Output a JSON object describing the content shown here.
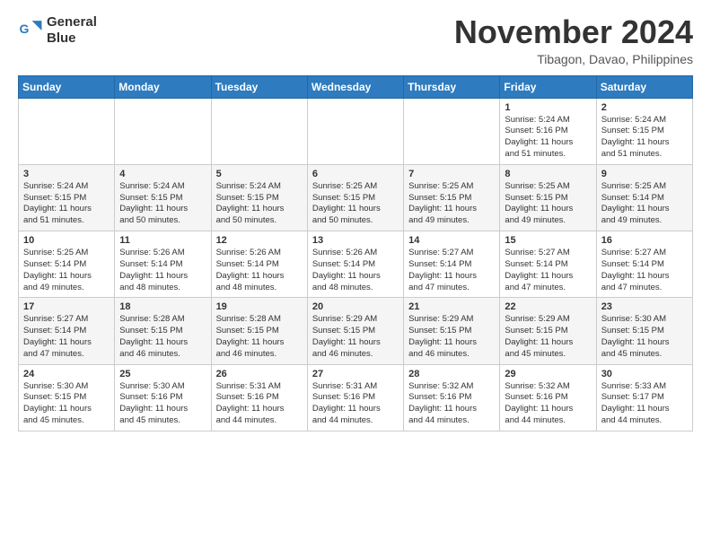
{
  "header": {
    "logo_line1": "General",
    "logo_line2": "Blue",
    "month_title": "November 2024",
    "location": "Tibagon, Davao, Philippines"
  },
  "days_of_week": [
    "Sunday",
    "Monday",
    "Tuesday",
    "Wednesday",
    "Thursday",
    "Friday",
    "Saturday"
  ],
  "weeks": [
    {
      "row_class": "row-1",
      "days": [
        {
          "num": "",
          "info": ""
        },
        {
          "num": "",
          "info": ""
        },
        {
          "num": "",
          "info": ""
        },
        {
          "num": "",
          "info": ""
        },
        {
          "num": "",
          "info": ""
        },
        {
          "num": "1",
          "info": "Sunrise: 5:24 AM\nSunset: 5:16 PM\nDaylight: 11 hours\nand 51 minutes."
        },
        {
          "num": "2",
          "info": "Sunrise: 5:24 AM\nSunset: 5:15 PM\nDaylight: 11 hours\nand 51 minutes."
        }
      ]
    },
    {
      "row_class": "row-2",
      "days": [
        {
          "num": "3",
          "info": "Sunrise: 5:24 AM\nSunset: 5:15 PM\nDaylight: 11 hours\nand 51 minutes."
        },
        {
          "num": "4",
          "info": "Sunrise: 5:24 AM\nSunset: 5:15 PM\nDaylight: 11 hours\nand 50 minutes."
        },
        {
          "num": "5",
          "info": "Sunrise: 5:24 AM\nSunset: 5:15 PM\nDaylight: 11 hours\nand 50 minutes."
        },
        {
          "num": "6",
          "info": "Sunrise: 5:25 AM\nSunset: 5:15 PM\nDaylight: 11 hours\nand 50 minutes."
        },
        {
          "num": "7",
          "info": "Sunrise: 5:25 AM\nSunset: 5:15 PM\nDaylight: 11 hours\nand 49 minutes."
        },
        {
          "num": "8",
          "info": "Sunrise: 5:25 AM\nSunset: 5:15 PM\nDaylight: 11 hours\nand 49 minutes."
        },
        {
          "num": "9",
          "info": "Sunrise: 5:25 AM\nSunset: 5:14 PM\nDaylight: 11 hours\nand 49 minutes."
        }
      ]
    },
    {
      "row_class": "row-3",
      "days": [
        {
          "num": "10",
          "info": "Sunrise: 5:25 AM\nSunset: 5:14 PM\nDaylight: 11 hours\nand 49 minutes."
        },
        {
          "num": "11",
          "info": "Sunrise: 5:26 AM\nSunset: 5:14 PM\nDaylight: 11 hours\nand 48 minutes."
        },
        {
          "num": "12",
          "info": "Sunrise: 5:26 AM\nSunset: 5:14 PM\nDaylight: 11 hours\nand 48 minutes."
        },
        {
          "num": "13",
          "info": "Sunrise: 5:26 AM\nSunset: 5:14 PM\nDaylight: 11 hours\nand 48 minutes."
        },
        {
          "num": "14",
          "info": "Sunrise: 5:27 AM\nSunset: 5:14 PM\nDaylight: 11 hours\nand 47 minutes."
        },
        {
          "num": "15",
          "info": "Sunrise: 5:27 AM\nSunset: 5:14 PM\nDaylight: 11 hours\nand 47 minutes."
        },
        {
          "num": "16",
          "info": "Sunrise: 5:27 AM\nSunset: 5:14 PM\nDaylight: 11 hours\nand 47 minutes."
        }
      ]
    },
    {
      "row_class": "row-4",
      "days": [
        {
          "num": "17",
          "info": "Sunrise: 5:27 AM\nSunset: 5:14 PM\nDaylight: 11 hours\nand 47 minutes."
        },
        {
          "num": "18",
          "info": "Sunrise: 5:28 AM\nSunset: 5:15 PM\nDaylight: 11 hours\nand 46 minutes."
        },
        {
          "num": "19",
          "info": "Sunrise: 5:28 AM\nSunset: 5:15 PM\nDaylight: 11 hours\nand 46 minutes."
        },
        {
          "num": "20",
          "info": "Sunrise: 5:29 AM\nSunset: 5:15 PM\nDaylight: 11 hours\nand 46 minutes."
        },
        {
          "num": "21",
          "info": "Sunrise: 5:29 AM\nSunset: 5:15 PM\nDaylight: 11 hours\nand 46 minutes."
        },
        {
          "num": "22",
          "info": "Sunrise: 5:29 AM\nSunset: 5:15 PM\nDaylight: 11 hours\nand 45 minutes."
        },
        {
          "num": "23",
          "info": "Sunrise: 5:30 AM\nSunset: 5:15 PM\nDaylight: 11 hours\nand 45 minutes."
        }
      ]
    },
    {
      "row_class": "row-5",
      "days": [
        {
          "num": "24",
          "info": "Sunrise: 5:30 AM\nSunset: 5:15 PM\nDaylight: 11 hours\nand 45 minutes."
        },
        {
          "num": "25",
          "info": "Sunrise: 5:30 AM\nSunset: 5:16 PM\nDaylight: 11 hours\nand 45 minutes."
        },
        {
          "num": "26",
          "info": "Sunrise: 5:31 AM\nSunset: 5:16 PM\nDaylight: 11 hours\nand 44 minutes."
        },
        {
          "num": "27",
          "info": "Sunrise: 5:31 AM\nSunset: 5:16 PM\nDaylight: 11 hours\nand 44 minutes."
        },
        {
          "num": "28",
          "info": "Sunrise: 5:32 AM\nSunset: 5:16 PM\nDaylight: 11 hours\nand 44 minutes."
        },
        {
          "num": "29",
          "info": "Sunrise: 5:32 AM\nSunset: 5:16 PM\nDaylight: 11 hours\nand 44 minutes."
        },
        {
          "num": "30",
          "info": "Sunrise: 5:33 AM\nSunset: 5:17 PM\nDaylight: 11 hours\nand 44 minutes."
        }
      ]
    }
  ]
}
